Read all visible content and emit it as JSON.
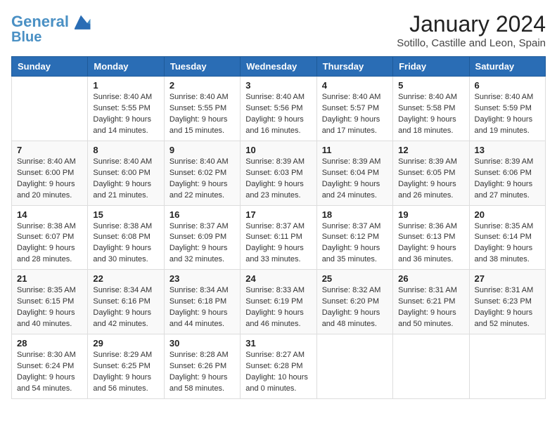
{
  "header": {
    "logo_line1": "General",
    "logo_line2": "Blue",
    "month_title": "January 2024",
    "subtitle": "Sotillo, Castille and Leon, Spain"
  },
  "weekdays": [
    "Sunday",
    "Monday",
    "Tuesday",
    "Wednesday",
    "Thursday",
    "Friday",
    "Saturday"
  ],
  "weeks": [
    [
      {
        "day": "",
        "info": ""
      },
      {
        "day": "1",
        "info": "Sunrise: 8:40 AM\nSunset: 5:55 PM\nDaylight: 9 hours\nand 14 minutes."
      },
      {
        "day": "2",
        "info": "Sunrise: 8:40 AM\nSunset: 5:55 PM\nDaylight: 9 hours\nand 15 minutes."
      },
      {
        "day": "3",
        "info": "Sunrise: 8:40 AM\nSunset: 5:56 PM\nDaylight: 9 hours\nand 16 minutes."
      },
      {
        "day": "4",
        "info": "Sunrise: 8:40 AM\nSunset: 5:57 PM\nDaylight: 9 hours\nand 17 minutes."
      },
      {
        "day": "5",
        "info": "Sunrise: 8:40 AM\nSunset: 5:58 PM\nDaylight: 9 hours\nand 18 minutes."
      },
      {
        "day": "6",
        "info": "Sunrise: 8:40 AM\nSunset: 5:59 PM\nDaylight: 9 hours\nand 19 minutes."
      }
    ],
    [
      {
        "day": "7",
        "info": ""
      },
      {
        "day": "8",
        "info": "Sunrise: 8:40 AM\nSunset: 6:00 PM\nDaylight: 9 hours\nand 21 minutes."
      },
      {
        "day": "9",
        "info": "Sunrise: 8:40 AM\nSunset: 6:02 PM\nDaylight: 9 hours\nand 22 minutes."
      },
      {
        "day": "10",
        "info": "Sunrise: 8:39 AM\nSunset: 6:03 PM\nDaylight: 9 hours\nand 23 minutes."
      },
      {
        "day": "11",
        "info": "Sunrise: 8:39 AM\nSunset: 6:04 PM\nDaylight: 9 hours\nand 24 minutes."
      },
      {
        "day": "12",
        "info": "Sunrise: 8:39 AM\nSunset: 6:05 PM\nDaylight: 9 hours\nand 26 minutes."
      },
      {
        "day": "13",
        "info": "Sunrise: 8:39 AM\nSunset: 6:06 PM\nDaylight: 9 hours\nand 27 minutes."
      }
    ],
    [
      {
        "day": "14",
        "info": ""
      },
      {
        "day": "15",
        "info": "Sunrise: 8:38 AM\nSunset: 6:08 PM\nDaylight: 9 hours\nand 30 minutes."
      },
      {
        "day": "16",
        "info": "Sunrise: 8:37 AM\nSunset: 6:09 PM\nDaylight: 9 hours\nand 32 minutes."
      },
      {
        "day": "17",
        "info": "Sunrise: 8:37 AM\nSunset: 6:11 PM\nDaylight: 9 hours\nand 33 minutes."
      },
      {
        "day": "18",
        "info": "Sunrise: 8:37 AM\nSunset: 6:12 PM\nDaylight: 9 hours\nand 35 minutes."
      },
      {
        "day": "19",
        "info": "Sunrise: 8:36 AM\nSunset: 6:13 PM\nDaylight: 9 hours\nand 36 minutes."
      },
      {
        "day": "20",
        "info": "Sunrise: 8:35 AM\nSunset: 6:14 PM\nDaylight: 9 hours\nand 38 minutes."
      }
    ],
    [
      {
        "day": "21",
        "info": ""
      },
      {
        "day": "22",
        "info": "Sunrise: 8:34 AM\nSunset: 6:16 PM\nDaylight: 9 hours\nand 42 minutes."
      },
      {
        "day": "23",
        "info": "Sunrise: 8:34 AM\nSunset: 6:18 PM\nDaylight: 9 hours\nand 44 minutes."
      },
      {
        "day": "24",
        "info": "Sunrise: 8:33 AM\nSunset: 6:19 PM\nDaylight: 9 hours\nand 46 minutes."
      },
      {
        "day": "25",
        "info": "Sunrise: 8:32 AM\nSunset: 6:20 PM\nDaylight: 9 hours\nand 48 minutes."
      },
      {
        "day": "26",
        "info": "Sunrise: 8:31 AM\nSunset: 6:21 PM\nDaylight: 9 hours\nand 50 minutes."
      },
      {
        "day": "27",
        "info": "Sunrise: 8:31 AM\nSunset: 6:23 PM\nDaylight: 9 hours\nand 52 minutes."
      }
    ],
    [
      {
        "day": "28",
        "info": "Sunrise: 8:30 AM\nSunset: 6:24 PM\nDaylight: 9 hours\nand 54 minutes."
      },
      {
        "day": "29",
        "info": "Sunrise: 8:29 AM\nSunset: 6:25 PM\nDaylight: 9 hours\nand 56 minutes."
      },
      {
        "day": "30",
        "info": "Sunrise: 8:28 AM\nSunset: 6:26 PM\nDaylight: 9 hours\nand 58 minutes."
      },
      {
        "day": "31",
        "info": "Sunrise: 8:27 AM\nSunset: 6:28 PM\nDaylight: 10 hours\nand 0 minutes."
      },
      {
        "day": "",
        "info": ""
      },
      {
        "day": "",
        "info": ""
      },
      {
        "day": "",
        "info": ""
      }
    ]
  ],
  "week1_sun_info": "Sunrise: 8:40 AM\nSunset: 6:00 PM\nDaylight: 9 hours\nand 20 minutes.",
  "week3_sun_info": "Sunrise: 8:38 AM\nSunset: 6:07 PM\nDaylight: 9 hours\nand 28 minutes.",
  "week4_sun_info": "Sunrise: 8:35 AM\nSunset: 6:15 PM\nDaylight: 9 hours\nand 40 minutes."
}
